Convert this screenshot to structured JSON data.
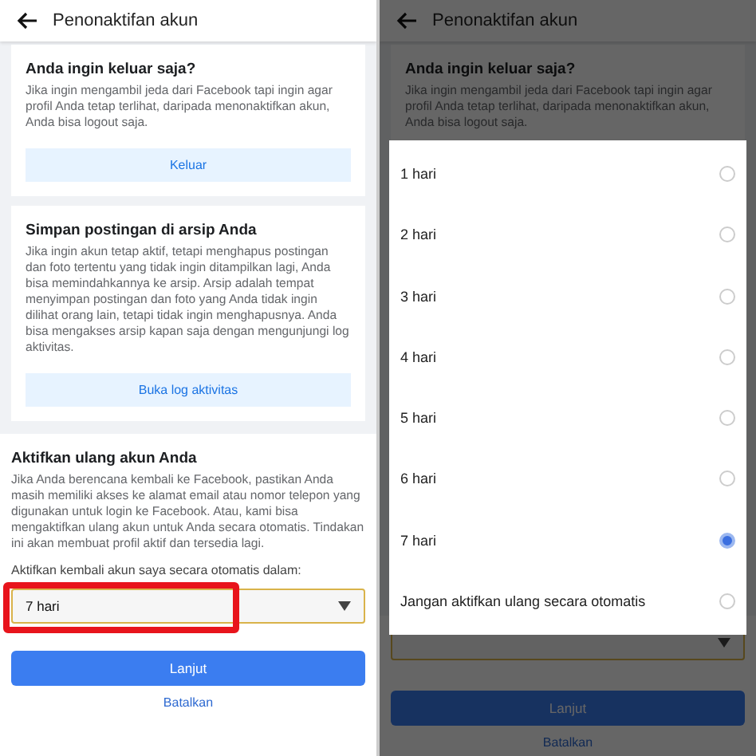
{
  "left": {
    "header": {
      "title": "Penonaktifan akun"
    },
    "cards": [
      {
        "title": "Anda ingin keluar saja?",
        "text": "Jika ingin mengambil jeda dari Facebook tapi ingin agar profil Anda tetap terlihat, daripada menonaktifkan akun, Anda bisa logout saja.",
        "button": "Keluar"
      },
      {
        "title": "Simpan postingan di arsip Anda",
        "text": "Jika ingin akun tetap aktif, tetapi menghapus postingan dan foto tertentu yang tidak ingin ditampilkan lagi, Anda bisa memindahkannya ke arsip. Arsip adalah tempat menyimpan postingan dan foto yang Anda tidak ingin dilihat orang lain, tetapi tidak ingin menghapusnya. Anda bisa mengakses arsip kapan saja dengan mengunjungi log aktivitas.",
        "button": "Buka log aktivitas"
      }
    ],
    "reactivate": {
      "title": "Aktifkan ulang akun Anda",
      "text": "Jika Anda berencana kembali ke Facebook, pastikan Anda masih memiliki akses ke alamat email atau nomor telepon yang digunakan untuk login ke Facebook. Atau, kami bisa mengaktifkan ulang akun untuk Anda secara otomatis. Tindakan ini akan membuat profil aktif dan tersedia lagi.",
      "dropdown_label": "Aktifkan kembali akun saya secara otomatis dalam:",
      "dropdown_value": "7 hari",
      "highlighted": true
    },
    "primary_button": "Lanjut",
    "cancel_link": "Batalkan"
  },
  "right": {
    "header": {
      "title": "Penonaktifan akun"
    },
    "card": {
      "title": "Anda ingin keluar saja?",
      "text": "Jika ingin mengambil jeda dari Facebook tapi ingin agar profil Anda tetap terlihat, daripada menonaktifkan akun, Anda bisa logout saja."
    },
    "dialog": {
      "options": [
        {
          "label": "1 hari",
          "selected": false
        },
        {
          "label": "2 hari",
          "selected": false
        },
        {
          "label": "3 hari",
          "selected": false
        },
        {
          "label": "4 hari",
          "selected": false
        },
        {
          "label": "5 hari",
          "selected": false
        },
        {
          "label": "6 hari",
          "selected": false
        },
        {
          "label": "7 hari",
          "selected": true
        },
        {
          "label": "Jangan aktifkan ulang secara otomatis",
          "selected": false
        }
      ]
    },
    "primary_button": "Lanjut",
    "cancel_link": "Batalkan"
  }
}
